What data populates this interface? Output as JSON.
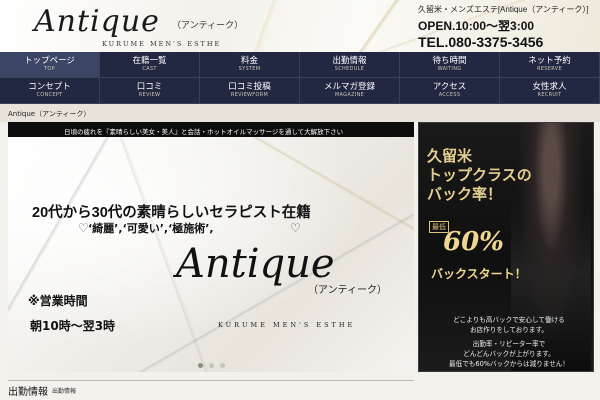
{
  "header": {
    "logo": "Antique",
    "logo_kana": "（アンティーク）",
    "logo_sub": "KURUME MEN'S ESTHE",
    "shop_name": "久留米・メンズエステ[Antique（アンティーク）]",
    "hours": "OPEN.10:00～翌3:00",
    "tel": "TEL.080-3375-3456"
  },
  "nav": [
    {
      "jp": "トップページ",
      "en": "TOP"
    },
    {
      "jp": "在籍一覧",
      "en": "CAST"
    },
    {
      "jp": "料金",
      "en": "SYSTEM"
    },
    {
      "jp": "出勤情報",
      "en": "SCHEDULE"
    },
    {
      "jp": "待ち時間",
      "en": "WAITING"
    },
    {
      "jp": "ネット予約",
      "en": "RESERVE"
    },
    {
      "jp": "コンセプト",
      "en": "CONCEPT"
    },
    {
      "jp": "口コミ",
      "en": "REVIEW"
    },
    {
      "jp": "口コミ投稿",
      "en": "REVIEWFORM"
    },
    {
      "jp": "メルマガ登録",
      "en": "MAGAZINE"
    },
    {
      "jp": "アクセス",
      "en": "ACCESS"
    },
    {
      "jp": "女性求人",
      "en": "RECRUIT"
    }
  ],
  "breadcrumb": "Antique（アンティーク）",
  "ticker": "日頃の疲れを『素晴らしい美女・美人』と会話・ホットオイルマッサージを通して大解放下さい",
  "banner": {
    "headline": "20代から30代の素晴らしいセラピスト在籍",
    "tags": "‘綺麗’,‘可愛い’,‘極施術’,",
    "logo": "Antique",
    "logo_kana": "（アンティーク）",
    "logo_sub": "KURUME MEN'S ESTHE",
    "hours_label": "※営業時間",
    "hours": "朝10時～翌3時"
  },
  "side_banner": {
    "title_line1": "久留米",
    "title_line2": "トップクラスの",
    "title_line3": "バック率！",
    "rate_label": "最低",
    "rate": "60%",
    "rate_sub": "バックスタート！",
    "text_line1": "どこよりも高バックで安心して働ける",
    "text_line2": "お店作りをしております。",
    "text_line3": "出勤率・リピーター率で",
    "text_line4": "どんどんバックが上がります。",
    "text_line5": "最低でも60%バックからは減りません！"
  },
  "attendance": {
    "title": "出勤情報",
    "sub": "出勤情報"
  },
  "colors": {
    "nav_bg": "#1f2338",
    "gold": "#e5cf90"
  }
}
